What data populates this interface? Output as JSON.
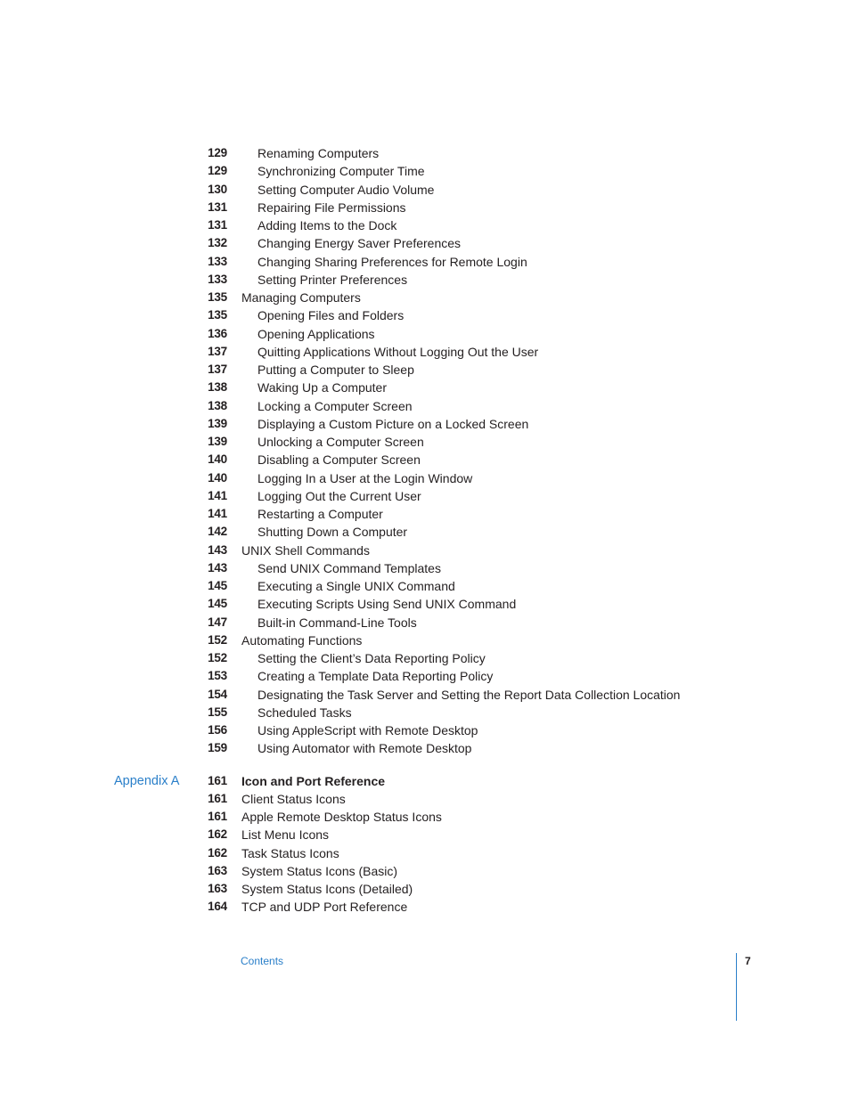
{
  "toc": {
    "entries": [
      {
        "page": "129",
        "title": "Renaming Computers",
        "level": 2
      },
      {
        "page": "129",
        "title": "Synchronizing Computer Time",
        "level": 2
      },
      {
        "page": "130",
        "title": "Setting Computer Audio Volume",
        "level": 2
      },
      {
        "page": "131",
        "title": "Repairing File Permissions",
        "level": 2
      },
      {
        "page": "131",
        "title": "Adding Items to the Dock",
        "level": 2
      },
      {
        "page": "132",
        "title": "Changing Energy Saver Preferences",
        "level": 2
      },
      {
        "page": "133",
        "title": "Changing Sharing Preferences for Remote Login",
        "level": 2
      },
      {
        "page": "133",
        "title": "Setting Printer Preferences",
        "level": 2
      },
      {
        "page": "135",
        "title": "Managing Computers",
        "level": 1
      },
      {
        "page": "135",
        "title": "Opening Files and Folders",
        "level": 2
      },
      {
        "page": "136",
        "title": "Opening Applications",
        "level": 2
      },
      {
        "page": "137",
        "title": "Quitting Applications Without Logging Out the User",
        "level": 2
      },
      {
        "page": "137",
        "title": "Putting a Computer to Sleep",
        "level": 2
      },
      {
        "page": "138",
        "title": "Waking Up a Computer",
        "level": 2
      },
      {
        "page": "138",
        "title": "Locking a Computer Screen",
        "level": 2
      },
      {
        "page": "139",
        "title": "Displaying a Custom Picture on a Locked Screen",
        "level": 2
      },
      {
        "page": "139",
        "title": "Unlocking a Computer Screen",
        "level": 2
      },
      {
        "page": "140",
        "title": "Disabling a Computer Screen",
        "level": 2
      },
      {
        "page": "140",
        "title": "Logging In a User at the Login Window",
        "level": 2
      },
      {
        "page": "141",
        "title": "Logging Out the Current User",
        "level": 2
      },
      {
        "page": "141",
        "title": "Restarting a Computer",
        "level": 2
      },
      {
        "page": "142",
        "title": "Shutting Down a Computer",
        "level": 2
      },
      {
        "page": "143",
        "title": "UNIX Shell Commands",
        "level": 1
      },
      {
        "page": "143",
        "title": "Send UNIX Command Templates",
        "level": 2
      },
      {
        "page": "145",
        "title": "Executing a Single UNIX Command",
        "level": 2
      },
      {
        "page": "145",
        "title": "Executing Scripts Using Send UNIX Command",
        "level": 2
      },
      {
        "page": "147",
        "title": "Built-in Command-Line Tools",
        "level": 2
      },
      {
        "page": "152",
        "title": "Automating Functions",
        "level": 1
      },
      {
        "page": "152",
        "title": "Setting the Client’s Data Reporting Policy",
        "level": 2
      },
      {
        "page": "153",
        "title": "Creating a Template Data Reporting Policy",
        "level": 2
      },
      {
        "page": "154",
        "title": "Designating the Task Server and Setting the Report Data Collection Location",
        "level": 2
      },
      {
        "page": "155",
        "title": "Scheduled Tasks",
        "level": 2
      },
      {
        "page": "156",
        "title": "Using AppleScript with Remote Desktop",
        "level": 2
      },
      {
        "page": "159",
        "title": "Using Automator with Remote Desktop",
        "level": 2
      }
    ],
    "appendix": {
      "label": "Appendix A",
      "page": "161",
      "title": "Icon and Port Reference",
      "entries": [
        {
          "page": "161",
          "title": "Client Status Icons"
        },
        {
          "page": "161",
          "title": "Apple Remote Desktop Status Icons"
        },
        {
          "page": "162",
          "title": "List Menu Icons"
        },
        {
          "page": "162",
          "title": "Task Status Icons"
        },
        {
          "page": "163",
          "title": "System Status Icons (Basic)"
        },
        {
          "page": "163",
          "title": "System Status Icons (Detailed)"
        },
        {
          "page": "164",
          "title": "TCP and UDP Port Reference"
        }
      ]
    }
  },
  "footer": {
    "section_label": "Contents",
    "page_number": "7"
  },
  "colors": {
    "accent": "#2a7fc9",
    "text": "#231f20"
  }
}
